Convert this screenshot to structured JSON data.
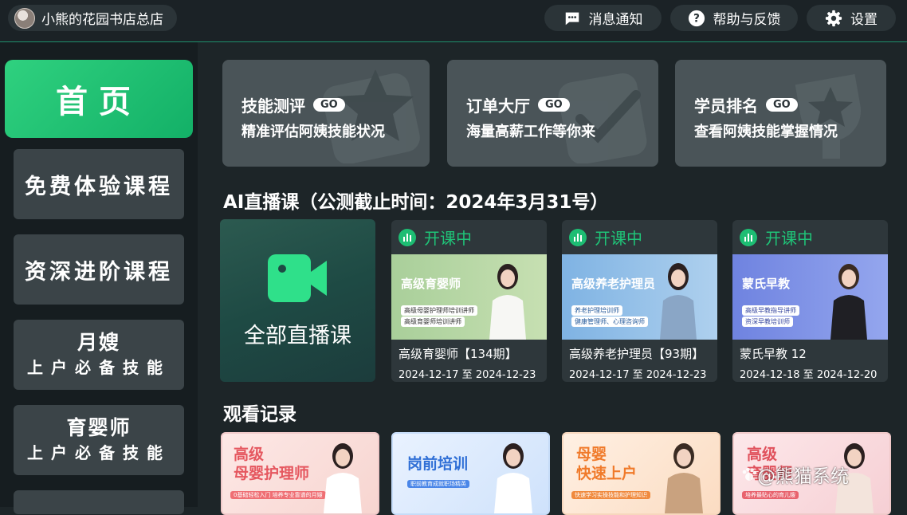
{
  "header": {
    "store_name": "小熊的花园书店总店",
    "messages": "消息通知",
    "help": "帮助与反馈",
    "settings": "设置"
  },
  "sidebar": {
    "home": "首页",
    "free": "免费体验课程",
    "advanced": "资深进阶课程",
    "item3_title": "月嫂",
    "item3_sub": "上户必备技能",
    "item4_title": "育婴师",
    "item4_sub": "上户必备技能"
  },
  "features": [
    {
      "title": "技能测评",
      "go": "GO",
      "subtitle": "精准评估阿姨技能状况"
    },
    {
      "title": "订单大厅",
      "go": "GO",
      "subtitle": "海量高薪工作等你来"
    },
    {
      "title": "学员排名",
      "go": "GO",
      "subtitle": "查看阿姨技能掌握情况"
    }
  ],
  "live_section_title": "AI直播课（公测截止时间：2024年3月31号）",
  "all_live_label": "全部直播课",
  "live_courses": [
    {
      "status": "开课中",
      "thumb_title": "高级育婴师",
      "thumb_line1": "高级母婴护理师培训讲师",
      "thumb_line2": "高级育婴师培训讲师",
      "title": "高级育婴师【134期】",
      "date": "2024-12-17 至 2024-12-23"
    },
    {
      "status": "开课中",
      "thumb_title": "高级养老护理员",
      "thumb_line1": "养老护理培训师",
      "thumb_line2": "健康管理师、心理咨询师",
      "title": "高级养老护理员【93期】",
      "date": "2024-12-17 至 2024-12-23"
    },
    {
      "status": "开课中",
      "thumb_title": "蒙氏早教",
      "thumb_line1": "高级早教指导讲师",
      "thumb_line2": "资深早教培训师",
      "title": "蒙氏早教 12",
      "date": "2024-12-18 至 2024-12-20"
    }
  ],
  "history_section_title": "观看记录",
  "history": [
    {
      "line1": "高级",
      "line2": "母婴护理师",
      "bar": "0基础轻松入门 培养专业靠谱的月嫂"
    },
    {
      "line1": "岗前培训",
      "line2": "",
      "bar": "职前教育成就职场精英"
    },
    {
      "line1": "母婴",
      "line2": "快速上户",
      "bar": "快速学习实操技能和护理知识"
    },
    {
      "line1": "高级",
      "line2": "育婴师",
      "bar": "培养最贴心的育儿嫂"
    }
  ],
  "watermark": "@熊猫系统",
  "colors": {
    "accent": "#1fc478",
    "home_green": "#2fd17f",
    "bg": "#1d2528"
  }
}
